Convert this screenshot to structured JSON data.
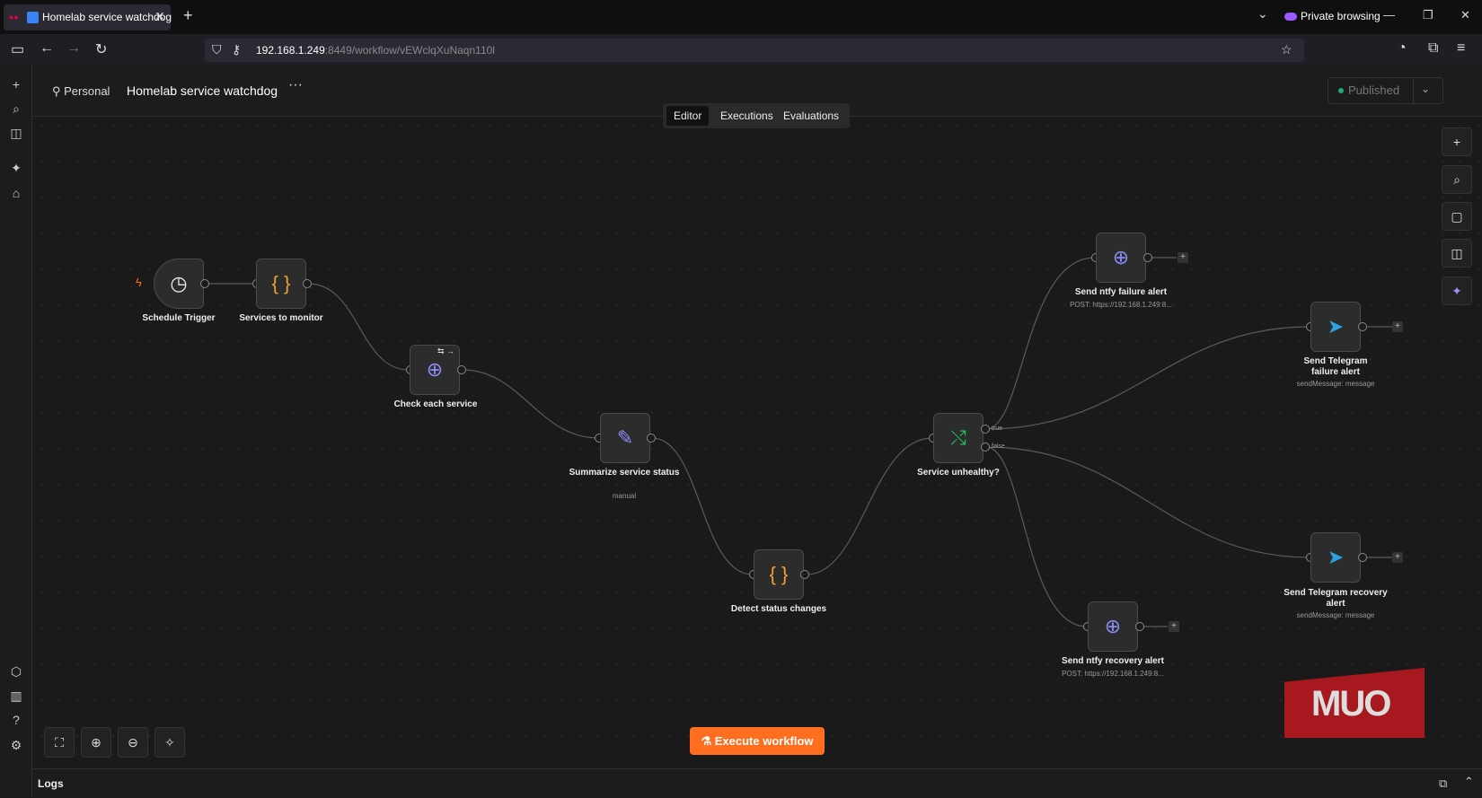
{
  "browser": {
    "tab_title": "Homelab service watchdog",
    "tab_close": "✕",
    "new_tab": "+",
    "private_label": "Private browsing",
    "url_host": "192.168.1.249",
    "url_rest": ":8449/workflow/vEWclqXuNaqn110l"
  },
  "header": {
    "project": "Personal",
    "workflow_name": "Homelab service watchdog",
    "menu": "···",
    "status": "Published"
  },
  "tabs": [
    "Editor",
    "Executions",
    "Evaluations"
  ],
  "nodes": {
    "schedule": {
      "label": "Schedule Trigger"
    },
    "services": {
      "label": "Services to monitor"
    },
    "check": {
      "label": "Check each service"
    },
    "summarize": {
      "label": "Summarize service status",
      "sub": "manual"
    },
    "detect": {
      "label": "Detect status changes"
    },
    "unhealthy": {
      "label": "Service unhealthy?",
      "true_label": "true",
      "false_label": "false"
    },
    "ntfy_fail": {
      "label": "Send ntfy failure alert",
      "sub": "POST: https://192.168.1.249:8..."
    },
    "tg_fail": {
      "label": "Send Telegram failure alert",
      "sub": "sendMessage: message"
    },
    "tg_recover": {
      "label": "Send Telegram recovery alert",
      "sub": "sendMessage: message"
    },
    "ntfy_recover": {
      "label": "Send ntfy recovery alert",
      "sub": "POST: https://192.168.1.249:8..."
    }
  },
  "execute_label": "Execute workflow",
  "logs_label": "Logs",
  "watermark": "MUO",
  "colors": {
    "accent": "#ff6d1f",
    "code": "#f0a030",
    "http": "#8b8cf7",
    "telegram": "#2aa3e0",
    "if": "#22c55e"
  }
}
